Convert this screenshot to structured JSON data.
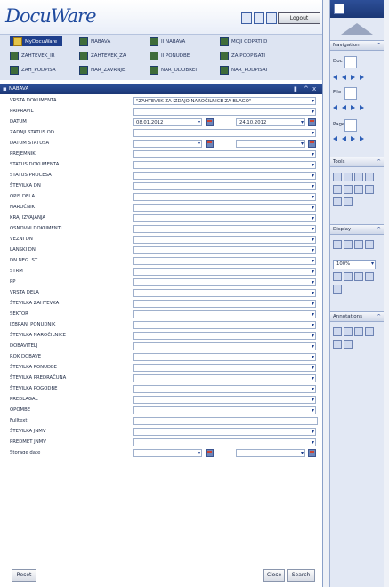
{
  "app": {
    "logo": "DocuWare",
    "logout_label": "Logout"
  },
  "nav": {
    "items": [
      {
        "label": "MyDocuWare",
        "active": true
      },
      {
        "label": "NABAVA"
      },
      {
        "label": "II NABAVA"
      },
      {
        "label": "MOJI ODPRTI D"
      },
      {
        "label": "ZAHTEVEK_IR"
      },
      {
        "label": "ZAHTEVEK_ZA"
      },
      {
        "label": "II PONUDBE"
      },
      {
        "label": "ZA PODPISATI"
      },
      {
        "label": "ZAH_PODPISA"
      },
      {
        "label": "NAR_ZAVRNJE"
      },
      {
        "label": "NAR_ODOBREI"
      },
      {
        "label": "NAR_PODPISAI"
      }
    ]
  },
  "panel": {
    "title": "NABAVA",
    "reset_label": "Reset",
    "close_label": "Close",
    "search_label": "Search"
  },
  "form": {
    "fields": [
      {
        "label": "VRSTA DOKUMENTA",
        "value": "\"ZAHTEVEK ZA IZDAJO NAROČILNICE ZA BLAGO\""
      },
      {
        "label": "PRIPRAVIL",
        "value": ""
      },
      {
        "label": "DATUM",
        "value_from": "08.01.2012",
        "value_to": "24.10.2012"
      },
      {
        "label": "ZADNJI STATUS OD",
        "value": ""
      },
      {
        "label": "DATUM STATUSA",
        "value_from": "",
        "value_to": ""
      },
      {
        "label": "PREJEMNIK",
        "value": ""
      },
      {
        "label": "STATUS DOKUMENTA",
        "value": ""
      },
      {
        "label": "STATUS PROCESA",
        "value": ""
      },
      {
        "label": "ŠTEVILKA DN",
        "value": ""
      },
      {
        "label": "OPIS DELA",
        "value": ""
      },
      {
        "label": "NAROČNIK",
        "value": ""
      },
      {
        "label": "KRAJ IZVAJANJA",
        "value": ""
      },
      {
        "label": "OSNOVNI DOKUMENTI",
        "value": ""
      },
      {
        "label": "VEZNI DN",
        "value": ""
      },
      {
        "label": "LANSKI DN",
        "value": ""
      },
      {
        "label": "DN NEG. ST.",
        "value": ""
      },
      {
        "label": "STRM",
        "value": ""
      },
      {
        "label": "PP",
        "value": ""
      },
      {
        "label": "VRSTA DELA",
        "value": ""
      },
      {
        "label": "ŠTEVILKA ZAHTEVKA",
        "value": ""
      },
      {
        "label": "SEKTOR",
        "value": ""
      },
      {
        "label": "IZBRANI PONUDNIK",
        "value": ""
      },
      {
        "label": "ŠTEVILKA NAROČILNICE",
        "value": ""
      },
      {
        "label": "DOBAVITELJ",
        "value": ""
      },
      {
        "label": "ROK DOBAVE",
        "value": ""
      },
      {
        "label": "ŠTEVILKA PONUDBE",
        "value": ""
      },
      {
        "label": "ŠTEVILKA PREDRAČUNA",
        "value": ""
      },
      {
        "label": "ŠTEVILKA POGODBE",
        "value": ""
      },
      {
        "label": "PREDLAGAL",
        "value": ""
      },
      {
        "label": "OPOMBE",
        "value": ""
      },
      {
        "label": "Fulltext",
        "value": ""
      },
      {
        "label": "ŠTEVILKA JNMV",
        "value": ""
      },
      {
        "label": "PREDMET JNMV",
        "value": ""
      },
      {
        "label": "Storage date",
        "value_from": "",
        "value_to": ""
      }
    ]
  },
  "sidebar": {
    "navigation_title": "Navigation",
    "doc_label": "Doc",
    "file_label": "File",
    "page_label": "Page",
    "tools_title": "Tools",
    "display_title": "Display",
    "zoom_value": "100%",
    "annotations_title": "Annotations"
  }
}
